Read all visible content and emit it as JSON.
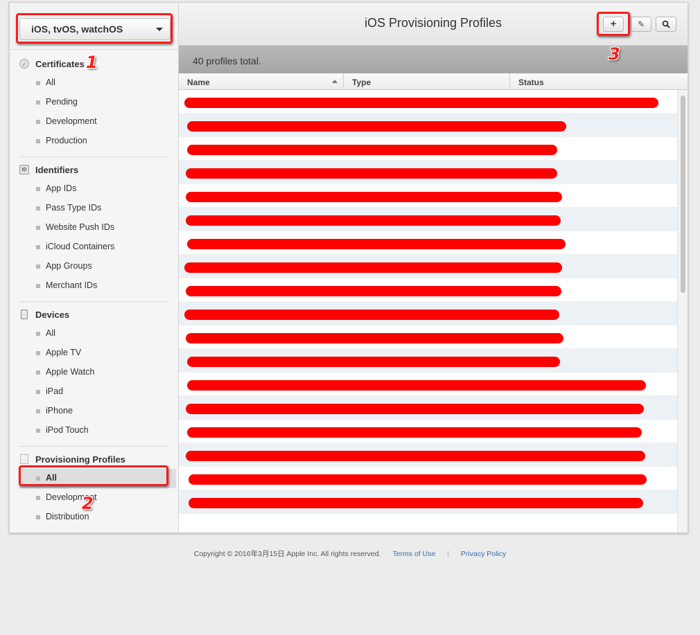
{
  "sidebar": {
    "platform": "iOS, tvOS, watchOS",
    "sections": [
      {
        "title": "Certificates",
        "icon": "certificate-icon",
        "items": [
          "All",
          "Pending",
          "Development",
          "Production"
        ]
      },
      {
        "title": "Identifiers",
        "icon": "id-icon",
        "icon_text": "ID",
        "items": [
          "App IDs",
          "Pass Type IDs",
          "Website Push IDs",
          "iCloud Containers",
          "App Groups",
          "Merchant IDs"
        ]
      },
      {
        "title": "Devices",
        "icon": "device-icon",
        "items": [
          "All",
          "Apple TV",
          "Apple Watch",
          "iPad",
          "iPhone",
          "iPod Touch"
        ]
      },
      {
        "title": "Provisioning Profiles",
        "icon": "document-icon",
        "items": [
          "All",
          "Development",
          "Distribution"
        ],
        "active_index": 0
      }
    ]
  },
  "header": {
    "title": "iOS Provisioning Profiles",
    "add_icon": "plus-icon",
    "edit_icon": "edit-icon",
    "search_icon": "search-icon"
  },
  "summary": "40 profiles total.",
  "table": {
    "columns": [
      "Name",
      "Type",
      "Status"
    ],
    "visible_rows": 18
  },
  "annotations": [
    "1",
    "2",
    "3"
  ],
  "footer": {
    "copyright": "Copyright © 2016年3月15日 Apple Inc. All rights reserved.",
    "terms": "Terms of Use",
    "separator": "|",
    "privacy": "Privacy Policy"
  }
}
